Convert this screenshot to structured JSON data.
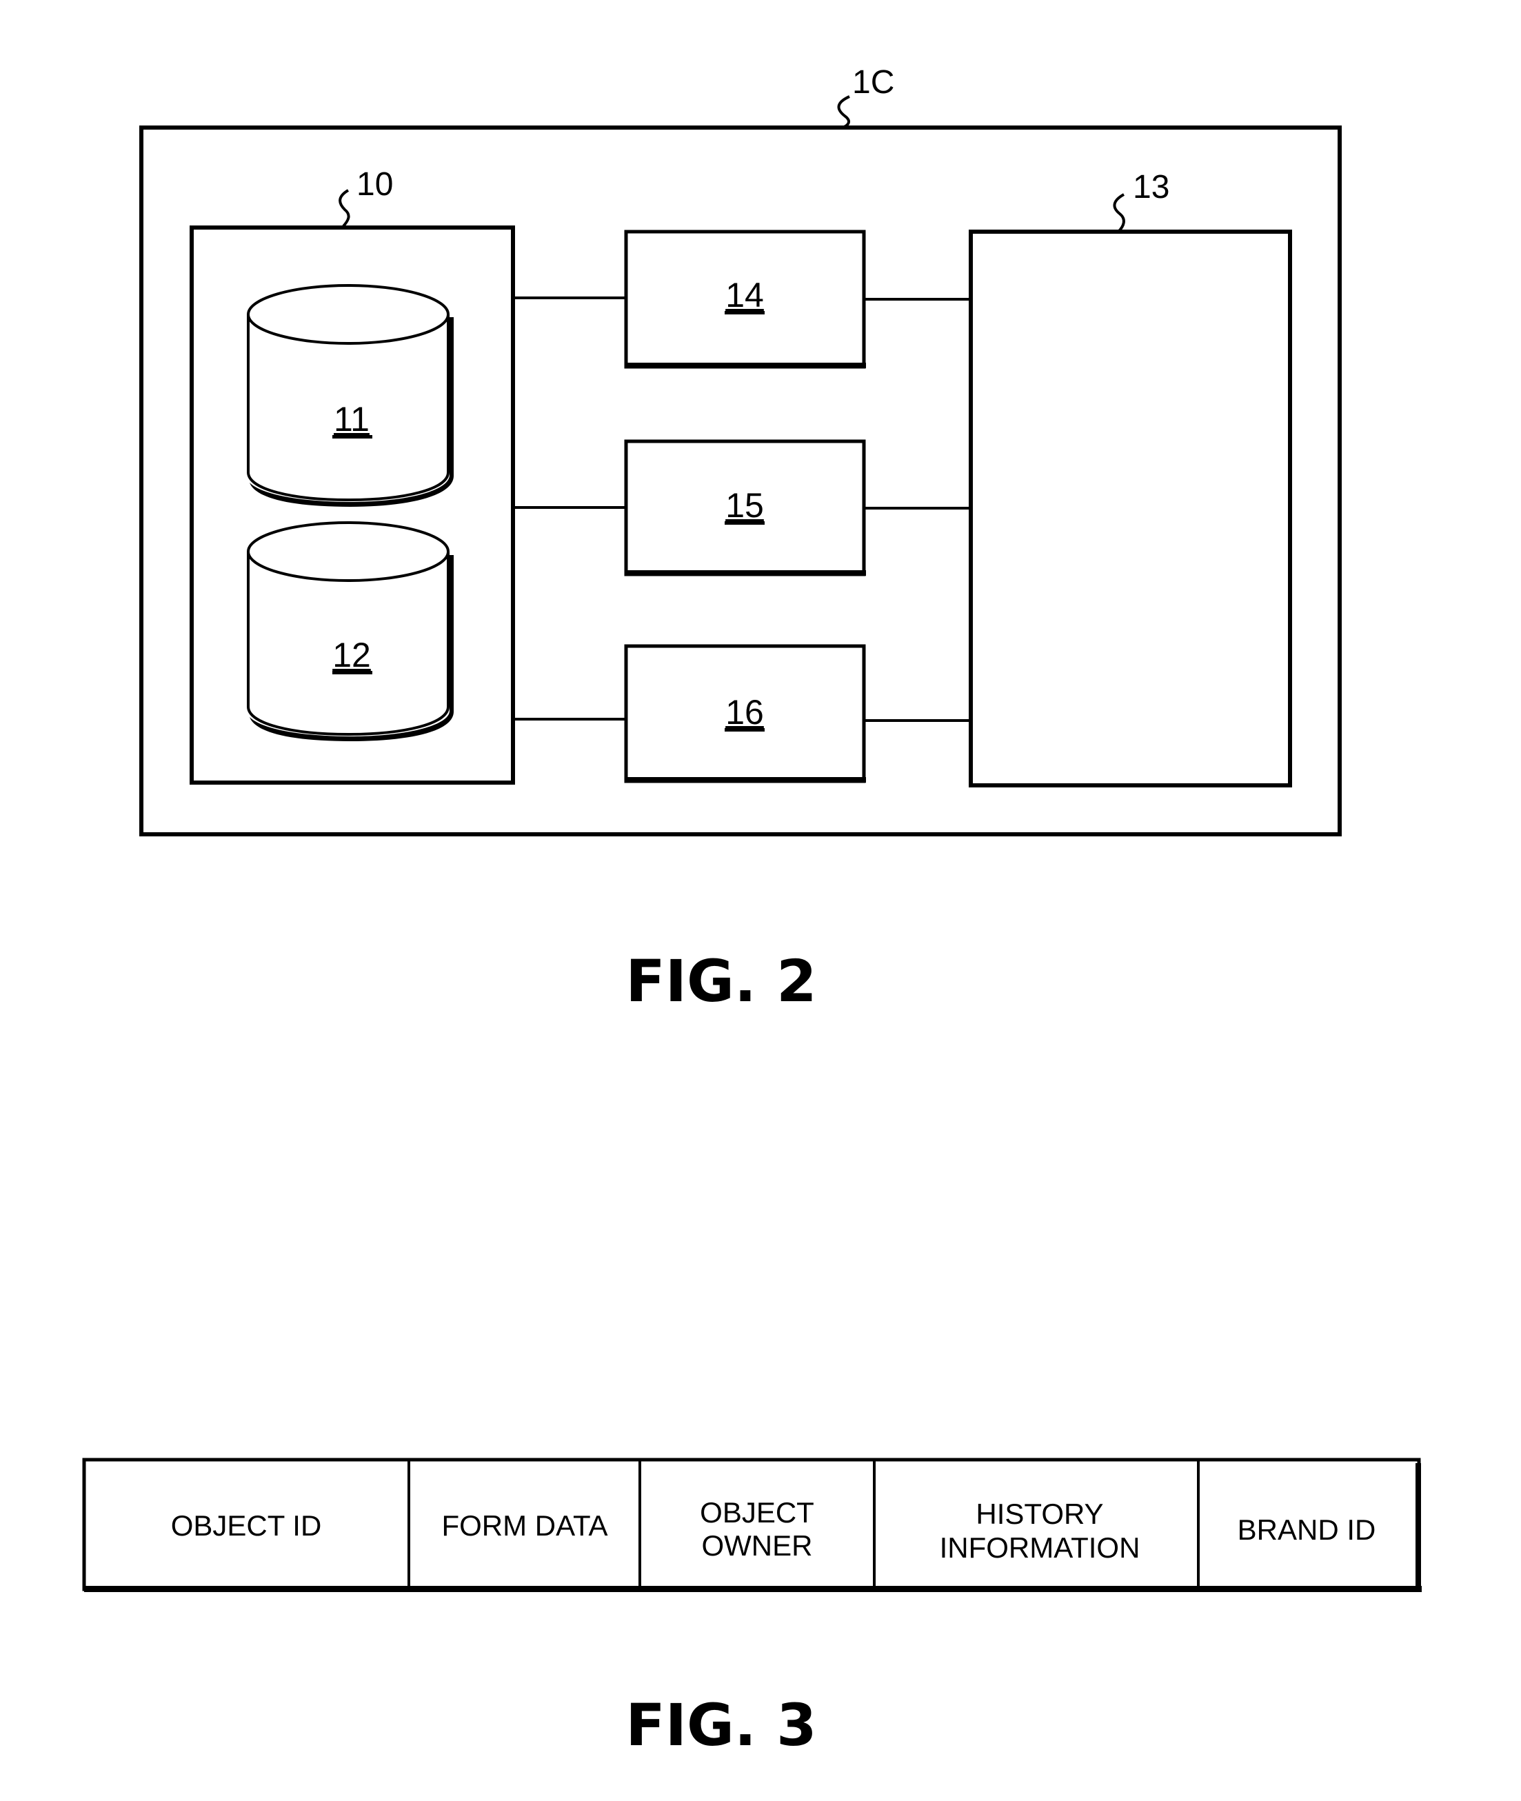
{
  "figure2": {
    "caption": "FIG. 2",
    "outer_ref": "1C",
    "storage_ref": "10",
    "processor_ref": "13",
    "databases": [
      {
        "label": "11"
      },
      {
        "label": "12"
      }
    ],
    "modules": [
      {
        "label": "14"
      },
      {
        "label": "15"
      },
      {
        "label": "16"
      }
    ]
  },
  "figure3": {
    "caption": "FIG. 3",
    "fields": [
      {
        "line1": "OBJECT ID",
        "line2": ""
      },
      {
        "line1": "FORM DATA",
        "line2": ""
      },
      {
        "line1": "OBJECT",
        "line2": "OWNER"
      },
      {
        "line1": "HISTORY",
        "line2": "INFORMATION"
      },
      {
        "line1": "BRAND ID",
        "line2": ""
      }
    ]
  }
}
